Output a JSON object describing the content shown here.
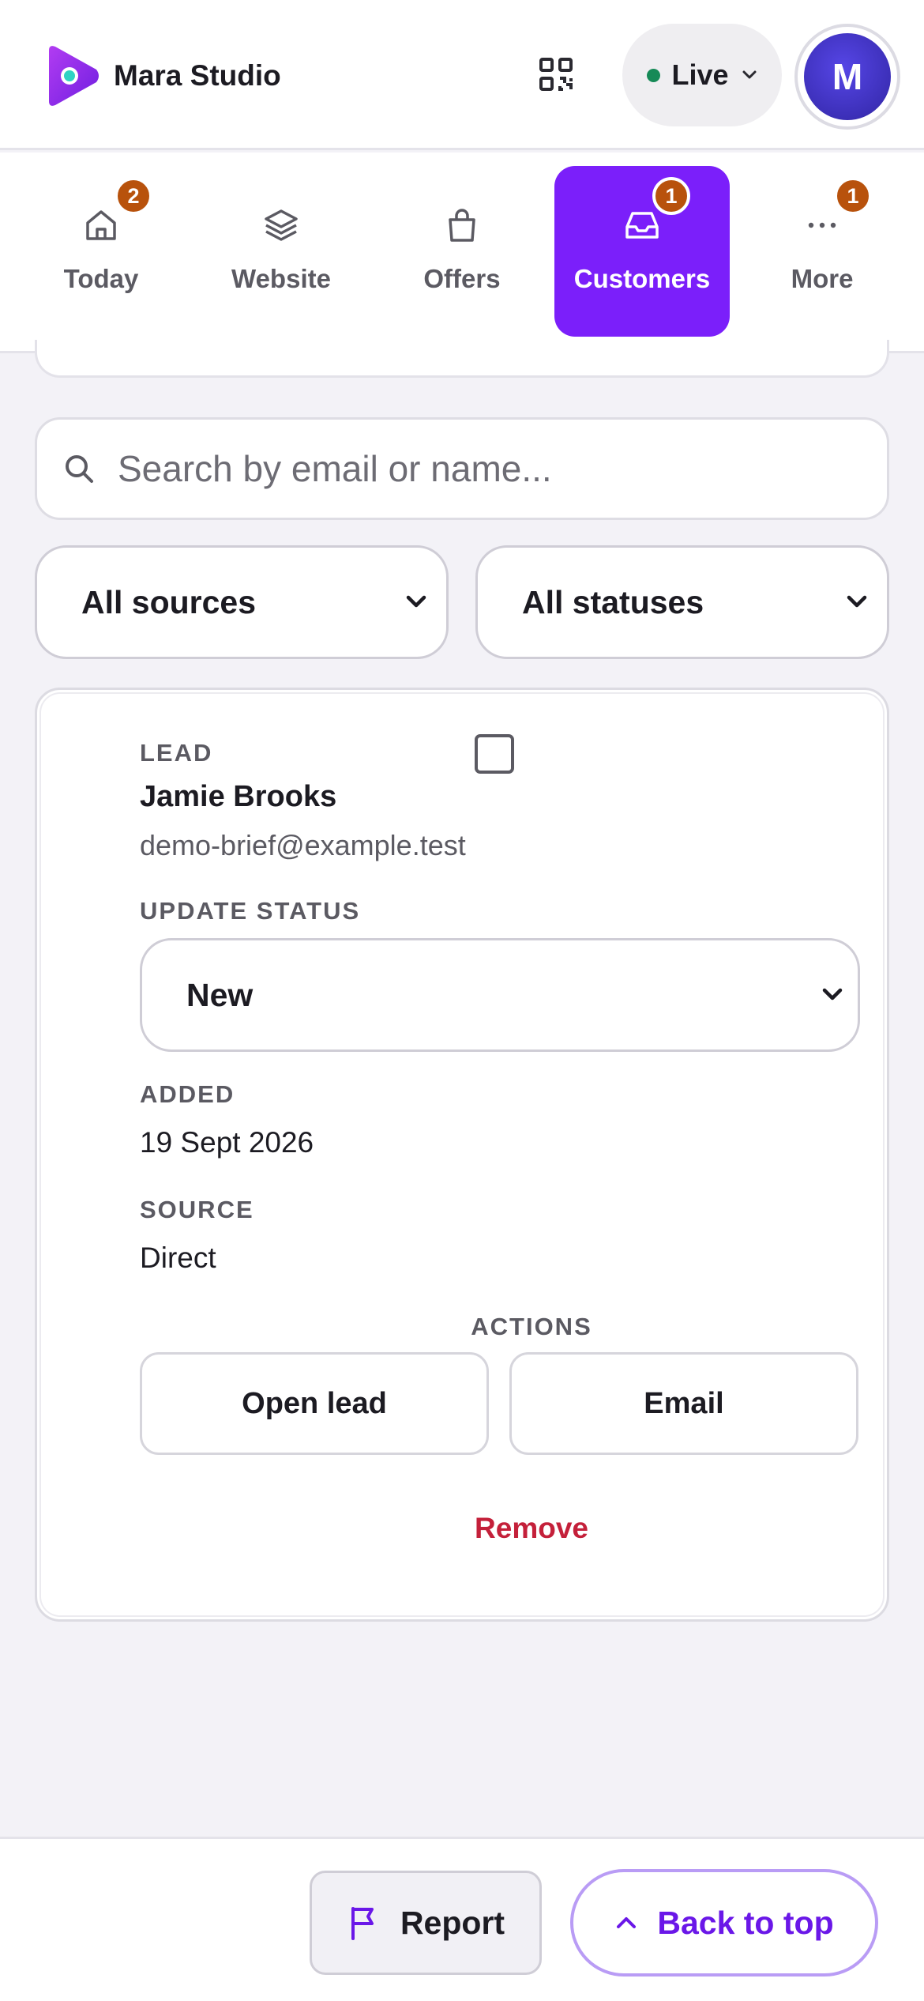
{
  "header": {
    "brand_name": "Mara Studio",
    "status_label": "Live",
    "status_color": "#168a57",
    "avatar_initial": "M",
    "qr_icon": "qr-code-icon"
  },
  "nav": {
    "tabs": [
      {
        "label": "Today",
        "icon": "home-icon",
        "badge": "2",
        "active": false
      },
      {
        "label": "Website",
        "icon": "layers-icon",
        "badge": "",
        "active": false
      },
      {
        "label": "Offers",
        "icon": "shopping-bag-icon",
        "badge": "",
        "active": false
      },
      {
        "label": "Customers",
        "icon": "inbox-icon",
        "badge": "1",
        "active": true
      },
      {
        "label": "More",
        "icon": "more-dots-icon",
        "badge": "1",
        "active": false
      }
    ],
    "active_color": "#7b1ffa",
    "badge_color": "#b8520c"
  },
  "filters": {
    "search_placeholder": "Search by email or name...",
    "source_selected": "All sources",
    "status_selected": "All statuses"
  },
  "lead": {
    "type_label": "LEAD",
    "name": "Jamie Brooks",
    "email": "demo-brief@example.test",
    "update_status_label": "UPDATE STATUS",
    "status_value": "New",
    "added_label": "ADDED",
    "added_value": "19 Sept 2026",
    "source_label": "SOURCE",
    "source_value": "Direct",
    "actions_label": "ACTIONS",
    "open_label": "Open lead",
    "email_label": "Email",
    "remove_label": "Remove",
    "remove_color": "#c4203a"
  },
  "footer": {
    "report_label": "Report",
    "back_to_top_label": "Back to top"
  }
}
